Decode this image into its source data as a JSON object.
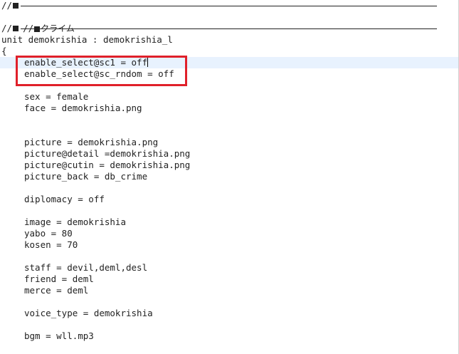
{
  "editor": {
    "comment_prefix": "//",
    "section_title": "クライム",
    "unit_header": "unit demokrishia : demokrishia_l",
    "open_brace": "{",
    "lines": {
      "enable_sc1": "enable_select@sc1 = off",
      "enable_sc_rndom": "enable_select@sc_rndom = off",
      "sex": "sex = female",
      "face": "face = demokrishia.png",
      "picture": "picture = demokrishia.png",
      "picture_detail": "picture@detail =demokrishia.png",
      "picture_cutin": "picture@cutin = demokrishia.png",
      "picture_back": "picture_back = db_crime",
      "diplomacy": "diplomacy = off",
      "image": "image = demokrishia",
      "yabo": "yabo = 80",
      "kosen": "kosen = 70",
      "staff": "staff = devil,deml,desl",
      "friend": "friend = deml",
      "merce": "merce = deml",
      "voice_type": "voice_type = demokrishia",
      "bgm": "bgm = wll.mp3"
    }
  },
  "colors": {
    "highlight_border": "#e0202a",
    "current_line_bg": "#e8f2fe"
  }
}
